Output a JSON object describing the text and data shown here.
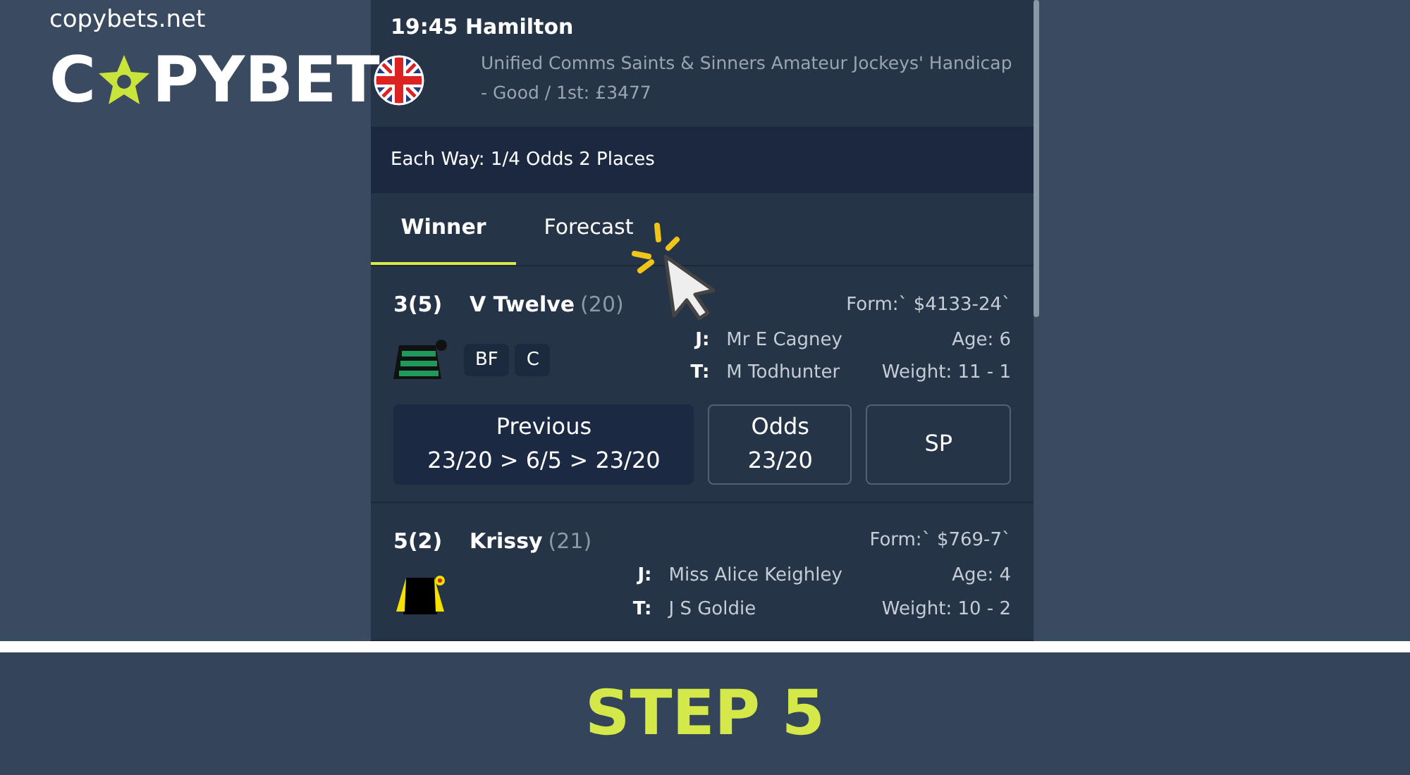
{
  "brand": {
    "site": "copybets.net",
    "logo_left": "C",
    "logo_right": "PYBET"
  },
  "race": {
    "title": "19:45 Hamilton",
    "name": "Unified Comms Saints & Sinners Amateur Jockeys' Handicap",
    "details": "- Good / 1st: £3477",
    "each_way": "Each Way: 1/4 Odds 2 Places"
  },
  "tabs": [
    {
      "label": "Winner",
      "selected": true
    },
    {
      "label": "Forecast",
      "selected": false
    }
  ],
  "runners": [
    {
      "number": "3",
      "draw": "(5)",
      "name": "V Twelve",
      "rating": "(20)",
      "form": "Form:` $4133-24`",
      "jockey": "Mr E Cagney",
      "trainer": "M Todhunter",
      "age": "Age: 6",
      "weight": "Weight: 11 - 1",
      "jockey_label": "J:",
      "trainer_label": "T:",
      "silk": {
        "kind": "stripes"
      },
      "tags": [
        "BF",
        "C"
      ],
      "previous_label": "Previous",
      "previous": "23/20 > 6/5 > 23/20",
      "odds_label": "Odds",
      "odds": "23/20",
      "sp": "SP"
    },
    {
      "number": "5",
      "draw": "(2)",
      "name": "Krissy",
      "rating": "(21)",
      "form": "Form:` $769-7`",
      "jockey": "Miss Alice Keighley",
      "trainer": "J S Goldie",
      "age": "Age: 4",
      "weight": "Weight: 10 - 2",
      "jockey_label": "J:",
      "trainer_label": "T:",
      "silk": {
        "kind": "yellow-sleeves"
      }
    }
  ],
  "step": "STEP 5"
}
